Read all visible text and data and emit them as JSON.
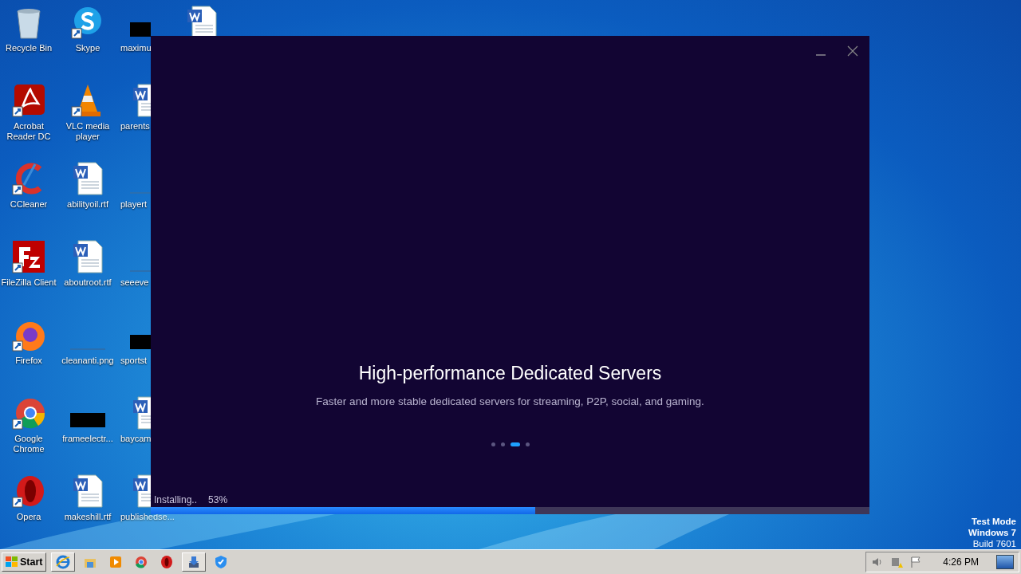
{
  "desktop": {
    "icons": [
      {
        "kind": "recycle",
        "label": "Recycle Bin"
      },
      {
        "kind": "pdf",
        "label": "Acrobat Reader DC"
      },
      {
        "kind": "ccleaner",
        "label": "CCleaner"
      },
      {
        "kind": "filezilla",
        "label": "FileZilla Client"
      },
      {
        "kind": "firefox",
        "label": "Firefox"
      },
      {
        "kind": "chrome",
        "label": "Google Chrome"
      },
      {
        "kind": "opera",
        "label": "Opera"
      },
      {
        "kind": "skype",
        "label": "Skype"
      },
      {
        "kind": "vlc",
        "label": "VLC media player"
      },
      {
        "kind": "word",
        "label": "abilityoil.rtf"
      },
      {
        "kind": "word",
        "label": "aboutroot.rtf"
      },
      {
        "kind": "image",
        "label": "cleananti.png"
      },
      {
        "kind": "redacted",
        "label": "frameelectr..."
      },
      {
        "kind": "word",
        "label": "makeshill.rtf"
      },
      {
        "kind": "redacted",
        "label": "maximu"
      },
      {
        "kind": "word",
        "label": "parents"
      },
      {
        "kind": "image",
        "label": "playert"
      },
      {
        "kind": "image",
        "label": "seeeve"
      },
      {
        "kind": "redacted",
        "label": "sportst"
      },
      {
        "kind": "word",
        "label": "baycam"
      },
      {
        "kind": "word",
        "label": "publishedse..."
      },
      {
        "kind": "word"
      }
    ]
  },
  "installer": {
    "title": "High-performance Dedicated Servers",
    "subtitle": "Faster and more stable dedicated servers for streaming, P2P, social, and gaming.",
    "slides": [
      {
        "selected": false
      },
      {
        "selected": false
      },
      {
        "selected": true
      },
      {
        "selected": false
      }
    ],
    "progress": {
      "status": "Installing..",
      "percent": "53%",
      "level": 0.535
    }
  },
  "system_notice": [
    "Test Mode",
    "Windows 7",
    "Build 7601"
  ],
  "taskbar": {
    "start": "Start",
    "apps": [
      {
        "kind": "ie",
        "open": true
      },
      {
        "kind": "explorer",
        "open": false
      },
      {
        "kind": "media",
        "open": false
      },
      {
        "kind": "chrome",
        "open": false
      },
      {
        "kind": "opera",
        "open": false
      },
      {
        "kind": "installer",
        "open": true
      },
      {
        "kind": "shield",
        "open": false
      }
    ],
    "clock": "4:26 PM"
  }
}
